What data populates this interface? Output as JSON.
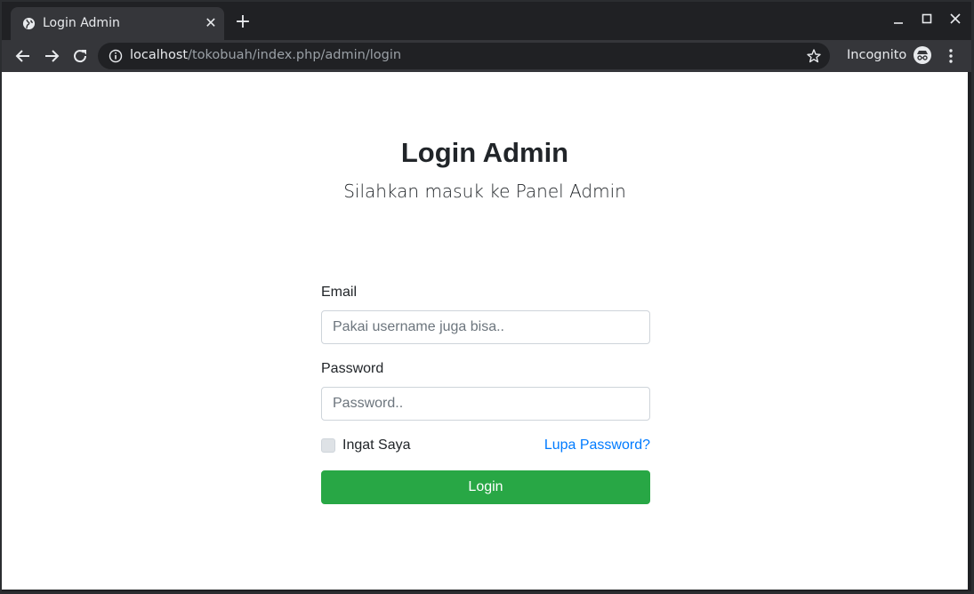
{
  "browser": {
    "tab_title": "Login Admin",
    "tab_close": "✕",
    "new_tab": "+",
    "url_host": "localhost",
    "url_path": "/tokobuah/index.php/admin/login",
    "incognito_label": "Incognito",
    "icons": {
      "favicon": "globe-icon",
      "back": "arrow-left-icon",
      "forward": "arrow-right-icon",
      "reload": "reload-icon",
      "info": "info-icon",
      "bookmark": "star-icon",
      "incognito": "incognito-icon",
      "menu": "kebab-menu-icon"
    }
  },
  "page": {
    "title": "Login Admin",
    "subtitle": "Silahkan masuk ke Panel Admin",
    "form": {
      "email_label": "Email",
      "email_placeholder": "Pakai username juga bisa..",
      "password_label": "Password",
      "password_placeholder": "Password..",
      "remember_label": "Ingat Saya",
      "forgot_label": "Lupa Password?",
      "submit_label": "Login"
    },
    "colors": {
      "submit": "#28a745",
      "link": "#007bff"
    }
  }
}
